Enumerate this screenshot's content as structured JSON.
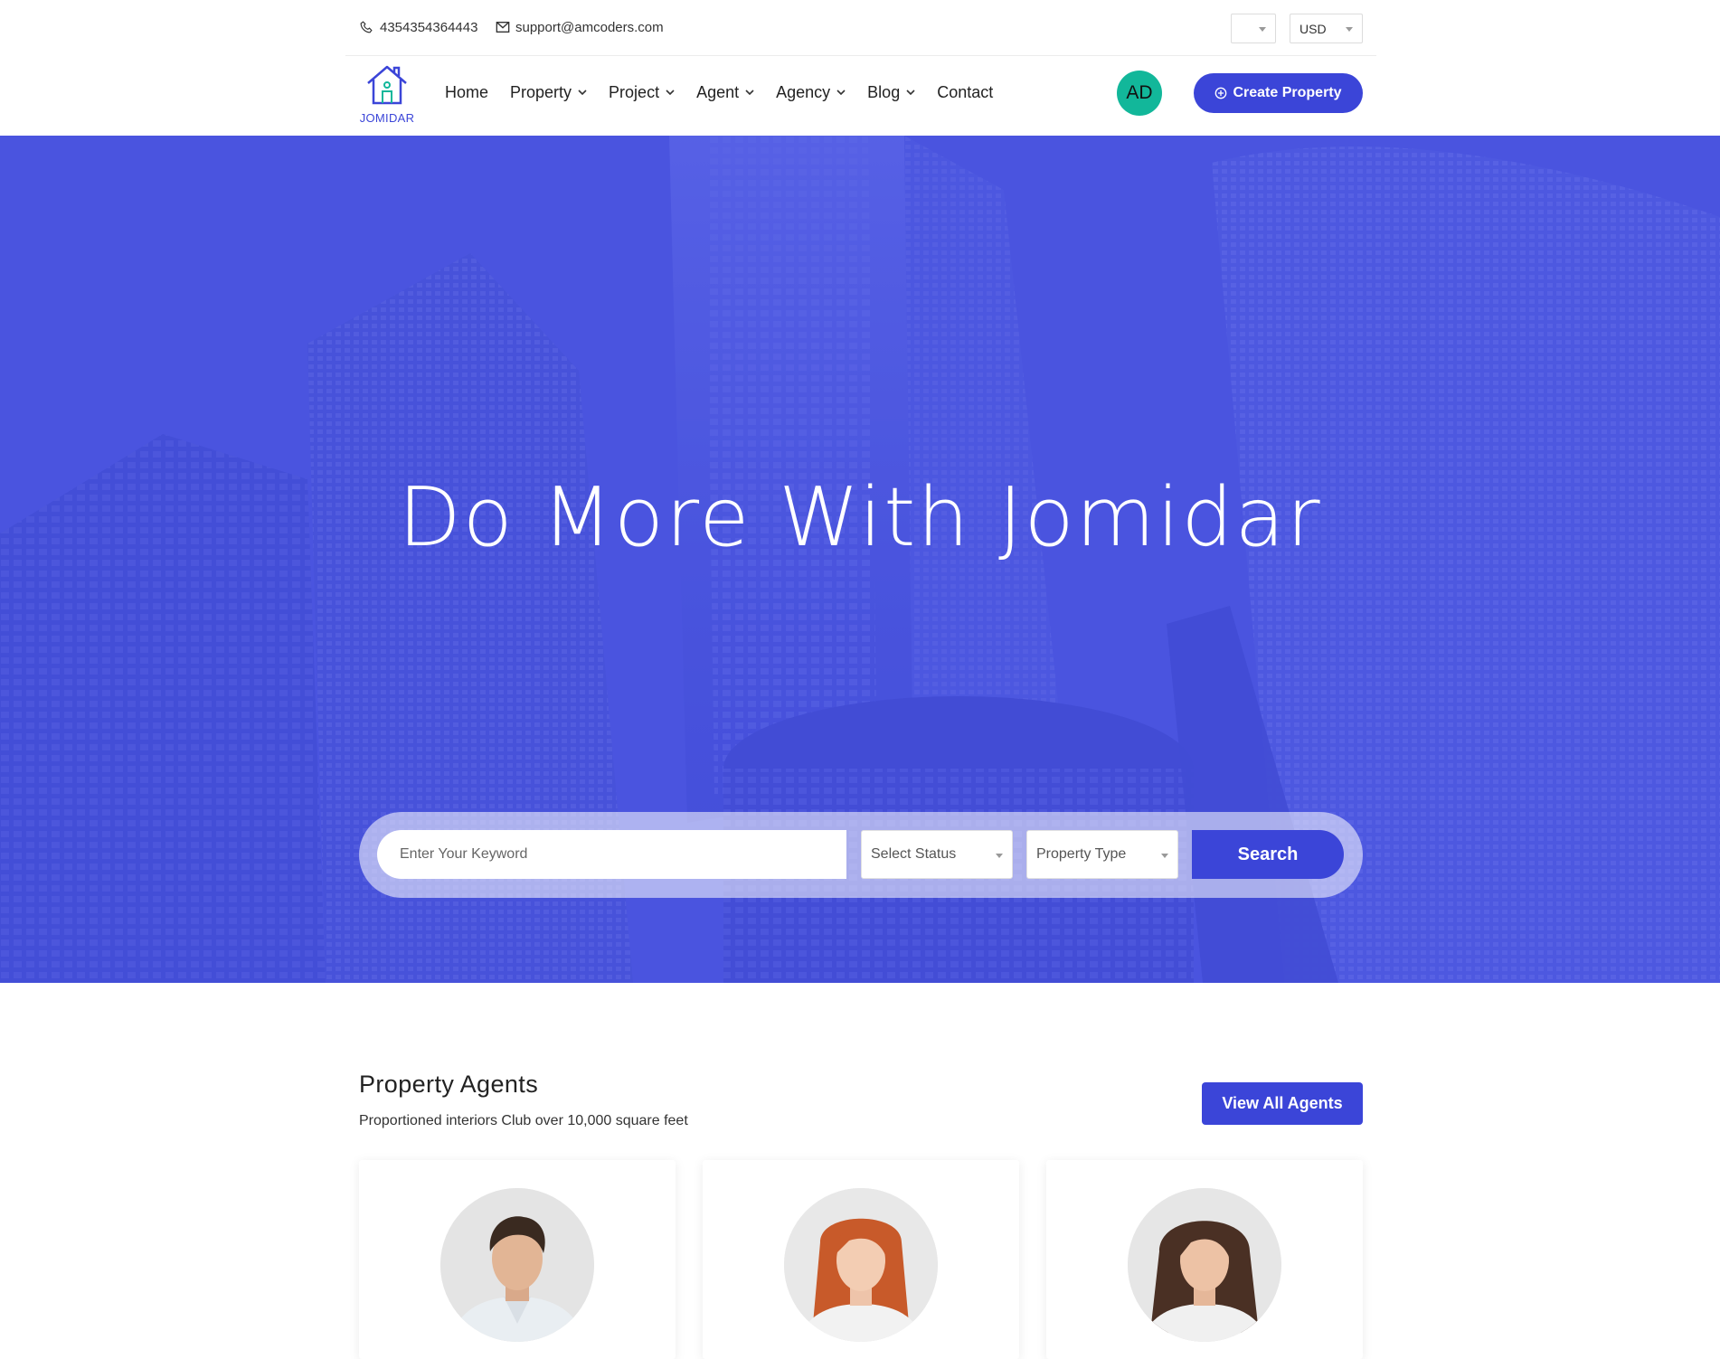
{
  "topbar": {
    "phone": "4354354364443",
    "email": "support@amcoders.com",
    "language_select": "",
    "currency_select": "USD"
  },
  "logo": {
    "text": "JOMIDAR"
  },
  "nav": {
    "items": [
      {
        "label": "Home",
        "dropdown": false
      },
      {
        "label": "Property",
        "dropdown": true
      },
      {
        "label": "Project",
        "dropdown": true
      },
      {
        "label": "Agent",
        "dropdown": true
      },
      {
        "label": "Agency",
        "dropdown": true
      },
      {
        "label": "Blog",
        "dropdown": true
      },
      {
        "label": "Contact",
        "dropdown": false
      }
    ],
    "avatar_initials": "AD",
    "create_button": "Create Property"
  },
  "hero": {
    "title": "Do More With Jomidar",
    "search": {
      "keyword_placeholder": "Enter Your Keyword",
      "status_select": "Select Status",
      "type_select": "Property Type",
      "button": "Search"
    }
  },
  "agents_section": {
    "title": "Property Agents",
    "subtitle": "Proportioned interiors Club over 10,000 square feet",
    "view_all": "View All Agents"
  },
  "colors": {
    "accent": "#3b45d8",
    "hero_overlay": "#4a55e0",
    "avatar_bg": "#12b79a"
  }
}
